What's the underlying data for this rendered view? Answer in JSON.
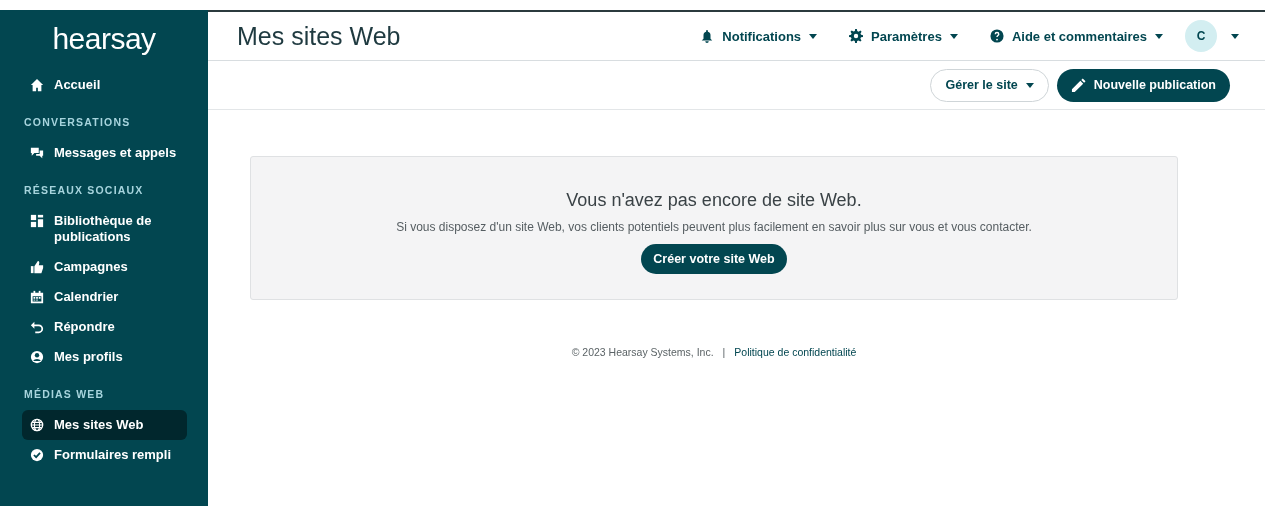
{
  "sidebar": {
    "logo": "hearsay",
    "sections": [
      {
        "items": [
          {
            "label": "Accueil",
            "selected": false
          }
        ]
      },
      {
        "heading": "CONVERSATIONS",
        "items": [
          {
            "label": "Messages et appels",
            "selected": false
          }
        ]
      },
      {
        "heading": "RÉSEAUX SOCIAUX",
        "items": [
          {
            "label": "Bibliothèque de publications",
            "selected": false
          },
          {
            "label": "Campagnes",
            "selected": false
          },
          {
            "label": "Calendrier",
            "selected": false
          },
          {
            "label": "Répondre",
            "selected": false
          },
          {
            "label": "Mes profils",
            "selected": false
          }
        ]
      },
      {
        "heading": "MÉDIAS WEB",
        "items": [
          {
            "label": "Mes sites Web",
            "selected": true
          },
          {
            "label": "Formulaires rempli",
            "selected": false
          }
        ]
      }
    ]
  },
  "header": {
    "title": "Mes sites Web",
    "menus": [
      "Notifications",
      "Paramètres",
      "Aide et commentaires"
    ],
    "avatar": "C"
  },
  "toolbar": {
    "manage_button": "Gérer le site",
    "new_button": "Nouvelle publication"
  },
  "empty_state": {
    "title": "Vous n'avez pas encore de site Web.",
    "text": "Si vous disposez d'un site Web, vos clients potentiels peuvent plus facilement en savoir plus sur vous et vous contacter.",
    "button": "Créer votre site Web"
  },
  "footer": {
    "copyright": "© 2023 Hearsay Systems, Inc.",
    "separator": "|",
    "link": "Politique de confidentialité"
  }
}
